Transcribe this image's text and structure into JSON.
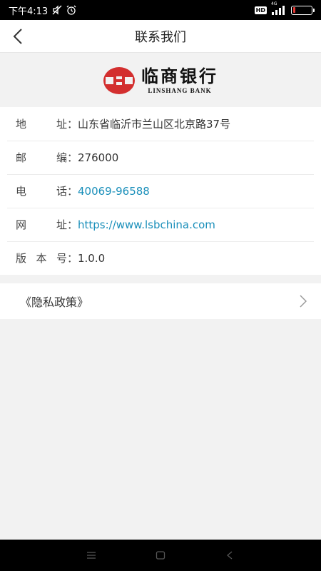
{
  "status_bar": {
    "time": "下午4:13",
    "hd_badge": "HD",
    "network": "4G",
    "battery_level": 0.15
  },
  "nav": {
    "title": "联系我们"
  },
  "logo": {
    "cn": "临商银行",
    "en": "LINSHANG BANK",
    "brand_color": "#d32f2f"
  },
  "info": {
    "address": {
      "label_chars": [
        "地",
        "址"
      ],
      "colon": "：",
      "value": "山东省临沂市兰山区北京路37号"
    },
    "postcode": {
      "label_chars": [
        "邮",
        "编"
      ],
      "colon": "：",
      "value": "276000"
    },
    "phone": {
      "label_chars": [
        "电",
        "话"
      ],
      "colon": "：",
      "value": "40069-96588"
    },
    "website": {
      "label_chars": [
        "网",
        "址"
      ],
      "colon": "：",
      "value": "https://www.lsbchina.com"
    },
    "version": {
      "label_chars": [
        "版",
        "本",
        "号"
      ],
      "colon": "：",
      "value": "1.0.0"
    }
  },
  "privacy": {
    "label": "《隐私政策》"
  },
  "colors": {
    "link": "#1a8fba",
    "status_bg": "#000000",
    "page_bg": "#f2f2f2"
  },
  "icons": [
    "mute-icon",
    "alarm-icon",
    "signal-icon",
    "battery-icon",
    "back-chevron-icon",
    "chevron-right-icon",
    "menu-icon",
    "home-icon",
    "back-triangle-icon"
  ]
}
